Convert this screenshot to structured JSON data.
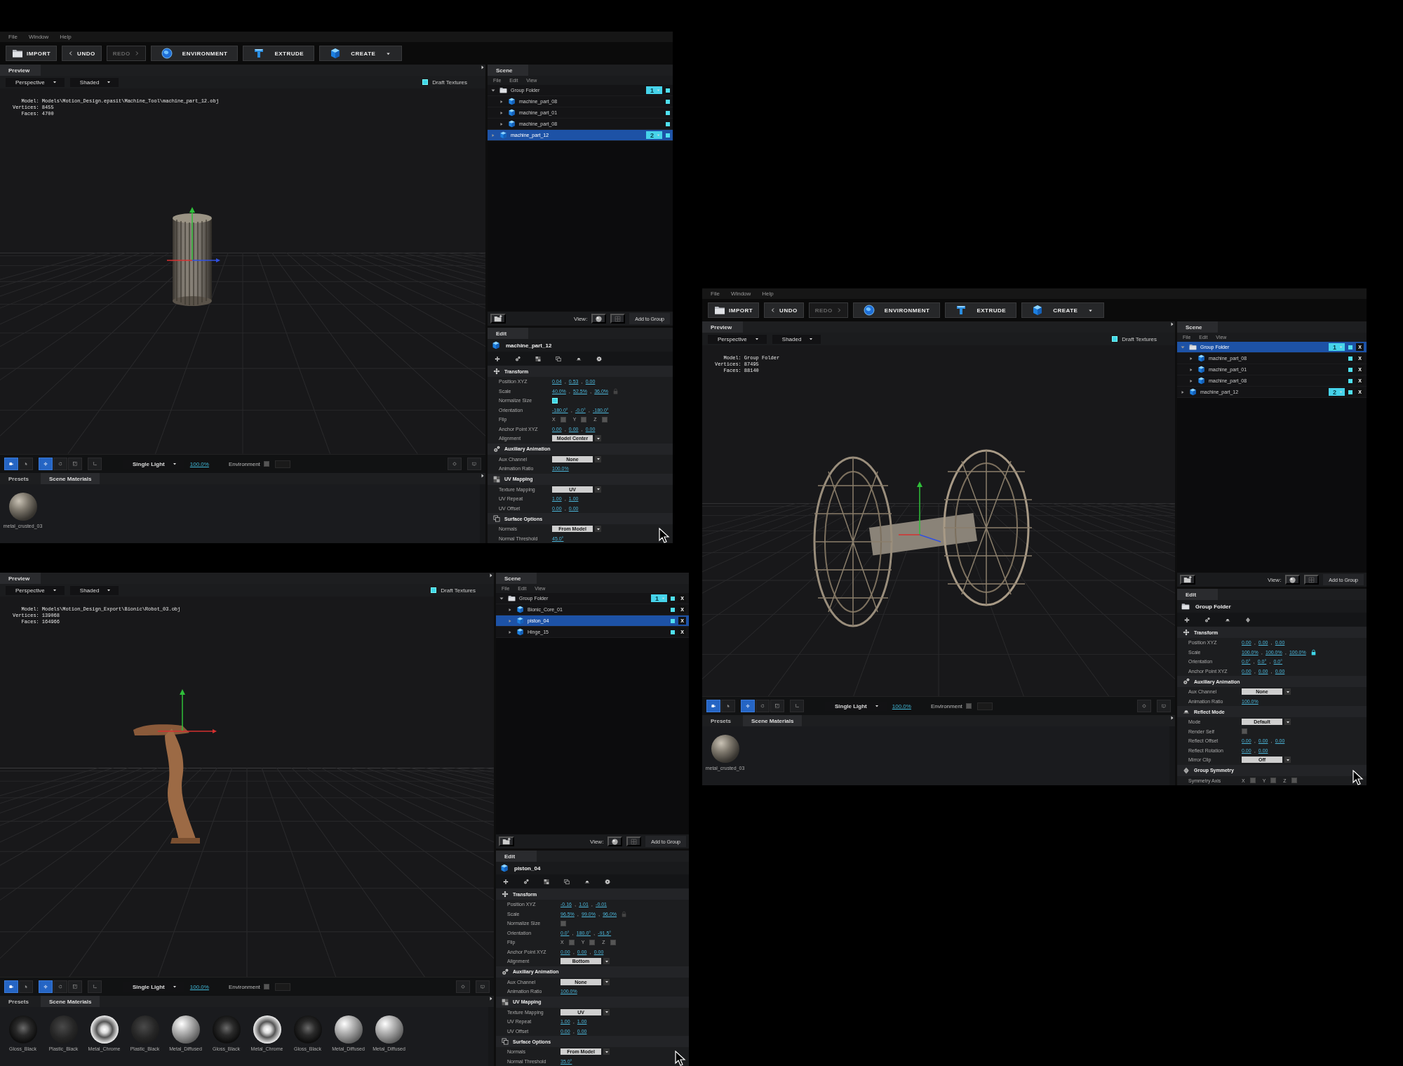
{
  "windows": [
    {
      "menu": [
        "File",
        "Window",
        "Help"
      ],
      "toolbar": [
        {
          "label": "IMPORT",
          "disabled": false
        },
        {
          "label": "UNDO",
          "disabled": false
        },
        {
          "label": "REDO",
          "disabled": true
        },
        {
          "label": "ENVIRONMENT",
          "disabled": false
        },
        {
          "label": "EXTRUDE",
          "disabled": false
        },
        {
          "label": "CREATE",
          "disabled": false,
          "dropdown": true
        }
      ],
      "preview": {
        "title": "Preview",
        "camera": "Perspective",
        "shading": "Shaded",
        "draft": {
          "label": "Draft Textures",
          "checked": true
        },
        "info": [
          {
            "label": "Model:",
            "value": "Models\\Motion_Design.epasit\\Machine_Tool\\machine_part_12.obj"
          },
          {
            "label": "Vertices:",
            "value": "8455"
          },
          {
            "label": "Faces:",
            "value": "4700"
          }
        ],
        "tools": [
          {
            "selected": true
          },
          {
            "selected": false
          },
          {
            "selected": true
          },
          {
            "selected": false
          },
          {
            "selected": false
          },
          {
            "selected": false
          }
        ],
        "light": "Single Light",
        "light_level": "100.0%",
        "environment": {
          "label": "Environment",
          "checked": false
        }
      },
      "materials": {
        "tabs": [
          {
            "label": "Presets",
            "selected": false
          },
          {
            "label": "Scene Materials",
            "selected": true
          }
        ],
        "items": [
          {
            "name": "metal_crusted_03",
            "kind": "crusted"
          }
        ]
      },
      "scene": {
        "title": "Scene",
        "menu": [
          "File",
          "Edit",
          "View"
        ],
        "view_label": "View:",
        "add_button": "Add to Group",
        "tree": [
          {
            "label": "Group Folder",
            "kind": "folder",
            "expanded": true,
            "selected": false,
            "layer": "1",
            "visible": true,
            "children": [
              {
                "label": "machine_part_08",
                "kind": "part",
                "expanded": false,
                "selected": false,
                "visible": true
              },
              {
                "label": "machine_part_01",
                "kind": "part",
                "expanded": false,
                "selected": false,
                "visible": true
              },
              {
                "label": "machine_part_08",
                "kind": "part",
                "expanded": false,
                "selected": false,
                "visible": true
              }
            ]
          },
          {
            "label": "machine_part_12",
            "kind": "part",
            "expanded": false,
            "selected": true,
            "layer": "2",
            "visible": true
          }
        ]
      },
      "edit": {
        "title": "Edit",
        "object": {
          "name": "machine_part_12",
          "kind": "part"
        },
        "sections": [
          {
            "title": "Transform",
            "kind": "transform",
            "rows": [
              {
                "label": "Position XYZ",
                "kind": "values",
                "values": [
                  "0.04",
                  "0.53",
                  "0.00"
                ],
                "separator": ","
              },
              {
                "label": "Scale",
                "kind": "values",
                "values": [
                  "40.0%",
                  "52.5%",
                  "36.0%"
                ],
                "separator": ",",
                "lock": false
              },
              {
                "label": "Normalize Size",
                "kind": "checkbox",
                "checked": true
              },
              {
                "label": "Orientation",
                "kind": "values",
                "values": [
                  "-180.0°",
                  "-0.0°",
                  "-180.0°"
                ],
                "separator": ","
              },
              {
                "label": "Flip",
                "kind": "axes",
                "axes": [
                  {
                    "label": "X",
                    "checked": false
                  },
                  {
                    "label": "Y",
                    "checked": false
                  },
                  {
                    "label": "Z",
                    "checked": false
                  }
                ]
              },
              {
                "label": "Anchor Point XYZ",
                "kind": "values",
                "values": [
                  "0.00",
                  "0.00",
                  "0.00"
                ],
                "separator": ","
              },
              {
                "label": "Alignment",
                "kind": "dropdown",
                "value": "Model Center"
              }
            ]
          },
          {
            "title": "Auxiliary Animation",
            "kind": "animation",
            "rows": [
              {
                "label": "Aux Channel",
                "kind": "dropdown",
                "value": "None"
              },
              {
                "label": "Animation Ratio",
                "kind": "values",
                "values": [
                  "100.0%"
                ]
              }
            ]
          },
          {
            "title": "UV Mapping",
            "kind": "uv",
            "rows": [
              {
                "label": "Texture Mapping",
                "kind": "dropdown",
                "value": "UV"
              },
              {
                "label": "UV Repeat",
                "kind": "values",
                "values": [
                  "1.00",
                  "1.00"
                ],
                "separator": ","
              },
              {
                "label": "UV Offset",
                "kind": "values",
                "values": [
                  "0.00",
                  "0.00"
                ],
                "separator": ","
              }
            ]
          },
          {
            "title": "Surface Options",
            "kind": "surface",
            "rows": [
              {
                "label": "Normals",
                "kind": "dropdown",
                "value": "From Model"
              },
              {
                "label": "Normal Threshold",
                "kind": "values",
                "values": [
                  "45.0°"
                ]
              }
            ]
          }
        ]
      }
    },
    {
      "menu": [
        "File",
        "Window",
        "Help"
      ],
      "toolbar": [
        {
          "label": "IMPORT",
          "disabled": false
        },
        {
          "label": "UNDO",
          "disabled": false
        },
        {
          "label": "REDO",
          "disabled": true
        },
        {
          "label": "ENVIRONMENT",
          "disabled": false
        },
        {
          "label": "EXTRUDE",
          "disabled": false
        },
        {
          "label": "CREATE",
          "disabled": false,
          "dropdown": true
        }
      ],
      "preview": {
        "title": "Preview",
        "camera": "Perspective",
        "shading": "Shaded",
        "draft": {
          "label": "Draft Textures",
          "checked": true
        },
        "info": [
          {
            "label": "Model:",
            "value": "Group Folder"
          },
          {
            "label": "Vertices:",
            "value": "87495"
          },
          {
            "label": "Faces:",
            "value": "88140"
          }
        ],
        "tools": [
          {
            "selected": true
          },
          {
            "selected": false
          },
          {
            "selected": true
          },
          {
            "selected": false
          },
          {
            "selected": false
          },
          {
            "selected": false
          }
        ],
        "light": "Single Light",
        "light_level": "100.0%",
        "environment": {
          "label": "Environment",
          "checked": false
        }
      },
      "materials": {
        "tabs": [
          {
            "label": "Presets",
            "selected": false
          },
          {
            "label": "Scene Materials",
            "selected": true
          }
        ],
        "items": [
          {
            "name": "metal_crusted_03",
            "kind": "crusted"
          }
        ]
      },
      "scene": {
        "title": "Scene",
        "menu": [
          "File",
          "Edit",
          "View"
        ],
        "view_label": "View:",
        "add_button": "Add to Group",
        "tree": [
          {
            "label": "Group Folder",
            "kind": "folder",
            "expanded": true,
            "selected": true,
            "layer": "1",
            "visible": true,
            "delete": "X",
            "children": [
              {
                "label": "machine_part_08",
                "kind": "part",
                "expanded": false,
                "selected": false,
                "visible": true,
                "delete": "X"
              },
              {
                "label": "machine_part_01",
                "kind": "part",
                "expanded": false,
                "selected": false,
                "visible": true,
                "delete": "X"
              },
              {
                "label": "machine_part_08",
                "kind": "part",
                "expanded": false,
                "selected": false,
                "visible": true,
                "delete": "X"
              }
            ]
          },
          {
            "label": "machine_part_12",
            "kind": "part",
            "expanded": false,
            "selected": false,
            "layer": "2",
            "visible": true,
            "delete": "X"
          }
        ]
      },
      "edit": {
        "title": "Edit",
        "object": {
          "name": "Group Folder",
          "kind": "folder"
        },
        "sections": [
          {
            "title": "Transform",
            "kind": "transform",
            "rows": [
              {
                "label": "Position XYZ",
                "kind": "values",
                "values": [
                  "0.00",
                  "0.00",
                  "0.00"
                ],
                "separator": ","
              },
              {
                "label": "Scale",
                "kind": "values",
                "values": [
                  "100.0%",
                  "100.0%",
                  "100.0%"
                ],
                "separator": ",",
                "lock": true
              },
              {
                "label": "Orientation",
                "kind": "values",
                "values": [
                  "0.0°",
                  "0.0°",
                  "0.0°"
                ],
                "separator": ","
              },
              {
                "label": "Anchor Point XYZ",
                "kind": "values",
                "values": [
                  "0.00",
                  "0.00",
                  "0.00"
                ],
                "separator": ","
              }
            ]
          },
          {
            "title": "Auxiliary Animation",
            "kind": "animation",
            "rows": [
              {
                "label": "Aux Channel",
                "kind": "dropdown",
                "value": "None"
              },
              {
                "label": "Animation Ratio",
                "kind": "values",
                "values": [
                  "100.0%"
                ]
              }
            ]
          },
          {
            "title": "Reflect Mode",
            "kind": "reflect",
            "rows": [
              {
                "label": "Mode",
                "kind": "dropdown",
                "value": "Default"
              },
              {
                "label": "Render Self",
                "kind": "checkbox",
                "checked": false
              },
              {
                "label": "Reflect Offset",
                "kind": "values",
                "values": [
                  "0.00",
                  "0.00",
                  "0.00"
                ],
                "separator": ","
              },
              {
                "label": "Reflect Rotation",
                "kind": "values",
                "values": [
                  "0.00",
                  "0.00"
                ],
                "separator": ","
              },
              {
                "label": "Mirror Clip",
                "kind": "dropdown",
                "value": "Off"
              }
            ]
          },
          {
            "title": "Group Symmetry",
            "kind": "symmetry",
            "rows": [
              {
                "label": "Symmetry Axis",
                "kind": "axes",
                "axes": [
                  {
                    "label": "X",
                    "checked": false
                  },
                  {
                    "label": "Y",
                    "checked": false
                  },
                  {
                    "label": "Z",
                    "checked": false
                  }
                ]
              }
            ]
          }
        ]
      }
    },
    {
      "preview": {
        "title": "Preview",
        "camera": "Perspective",
        "shading": "Shaded",
        "draft": {
          "label": "Draft Textures",
          "checked": true
        },
        "info": [
          {
            "label": "Model:",
            "value": "Models\\Motion_Design_Export\\Bionic\\Robot_03.obj"
          },
          {
            "label": "Vertices:",
            "value": "139068"
          },
          {
            "label": "Faces:",
            "value": "164966"
          }
        ],
        "tools": [
          {
            "selected": true
          },
          {
            "selected": false
          },
          {
            "selected": true
          },
          {
            "selected": false
          },
          {
            "selected": false
          },
          {
            "selected": false
          }
        ],
        "light": "Single Light",
        "light_level": "100.0%",
        "environment": {
          "label": "Environment",
          "checked": false
        }
      },
      "materials": {
        "tabs": [
          {
            "label": "Presets",
            "selected": false
          },
          {
            "label": "Scene Materials",
            "selected": true
          }
        ],
        "items": [
          {
            "name": "Gloss_Black",
            "kind": "gloss"
          },
          {
            "name": "Plastic_Black",
            "kind": "plastic"
          },
          {
            "name": "Metal_Chrome",
            "kind": "chrome"
          },
          {
            "name": "Plastic_Black",
            "kind": "plastic"
          },
          {
            "name": "Metal_Diffused",
            "kind": "diffused"
          },
          {
            "name": "Gloss_Black",
            "kind": "gloss"
          },
          {
            "name": "Metal_Chrome",
            "kind": "chrome"
          },
          {
            "name": "Gloss_Black",
            "kind": "gloss"
          },
          {
            "name": "Metal_Diffused",
            "kind": "diffused"
          },
          {
            "name": "Metal_Diffused",
            "kind": "diffused"
          }
        ]
      },
      "scene": {
        "title": "Scene",
        "menu": [
          "File",
          "Edit",
          "View"
        ],
        "view_label": "View:",
        "add_button": "Add to Group",
        "tree": [
          {
            "label": "Group Folder",
            "kind": "folder",
            "expanded": true,
            "selected": false,
            "layer": "1",
            "visible": true,
            "delete": "X",
            "children": [
              {
                "label": "Bionic_Core_01",
                "kind": "part",
                "expanded": false,
                "selected": false,
                "visible": true,
                "delete": "X"
              },
              {
                "label": "piston_04",
                "kind": "part",
                "expanded": false,
                "selected": true,
                "visible": true,
                "delete": "X"
              },
              {
                "label": "Hinge_15",
                "kind": "part",
                "expanded": false,
                "selected": false,
                "visible": true,
                "delete": "X"
              }
            ]
          }
        ]
      },
      "edit": {
        "title": "Edit",
        "object": {
          "name": "piston_04",
          "kind": "part"
        },
        "sections": [
          {
            "title": "Transform",
            "kind": "transform",
            "rows": [
              {
                "label": "Position XYZ",
                "kind": "values",
                "values": [
                  "-0.16",
                  "1.01",
                  "-0.01"
                ],
                "separator": ","
              },
              {
                "label": "Scale",
                "kind": "values",
                "values": [
                  "96.5%",
                  "99.0%",
                  "96.0%"
                ],
                "separator": ",",
                "lock": false
              },
              {
                "label": "Normalize Size",
                "kind": "checkbox",
                "checked": false
              },
              {
                "label": "Orientation",
                "kind": "values",
                "values": [
                  "0.0°",
                  "180.0°",
                  "-91.5°"
                ],
                "separator": ","
              },
              {
                "label": "Flip",
                "kind": "axes",
                "axes": [
                  {
                    "label": "X",
                    "checked": false
                  },
                  {
                    "label": "Y",
                    "checked": false
                  },
                  {
                    "label": "Z",
                    "checked": false
                  }
                ]
              },
              {
                "label": "Anchor Point XYZ",
                "kind": "values",
                "values": [
                  "0.00",
                  "0.00",
                  "0.00"
                ],
                "separator": ","
              },
              {
                "label": "Alignment",
                "kind": "dropdown",
                "value": "Bottom"
              }
            ]
          },
          {
            "title": "Auxiliary Animation",
            "kind": "animation",
            "rows": [
              {
                "label": "Aux Channel",
                "kind": "dropdown",
                "value": "None"
              },
              {
                "label": "Animation Ratio",
                "kind": "values",
                "values": [
                  "100.0%"
                ]
              }
            ]
          },
          {
            "title": "UV Mapping",
            "kind": "uv",
            "rows": [
              {
                "label": "Texture Mapping",
                "kind": "dropdown",
                "value": "UV"
              },
              {
                "label": "UV Repeat",
                "kind": "values",
                "values": [
                  "1.00",
                  "1.00"
                ],
                "separator": ","
              },
              {
                "label": "UV Offset",
                "kind": "values",
                "values": [
                  "0.00",
                  "0.00"
                ],
                "separator": ","
              }
            ]
          },
          {
            "title": "Surface Options",
            "kind": "surface",
            "rows": [
              {
                "label": "Normals",
                "kind": "dropdown",
                "value": "From Model"
              },
              {
                "label": "Normal Threshold",
                "kind": "values",
                "values": [
                  "35.0°"
                ]
              }
            ]
          }
        ]
      }
    }
  ]
}
